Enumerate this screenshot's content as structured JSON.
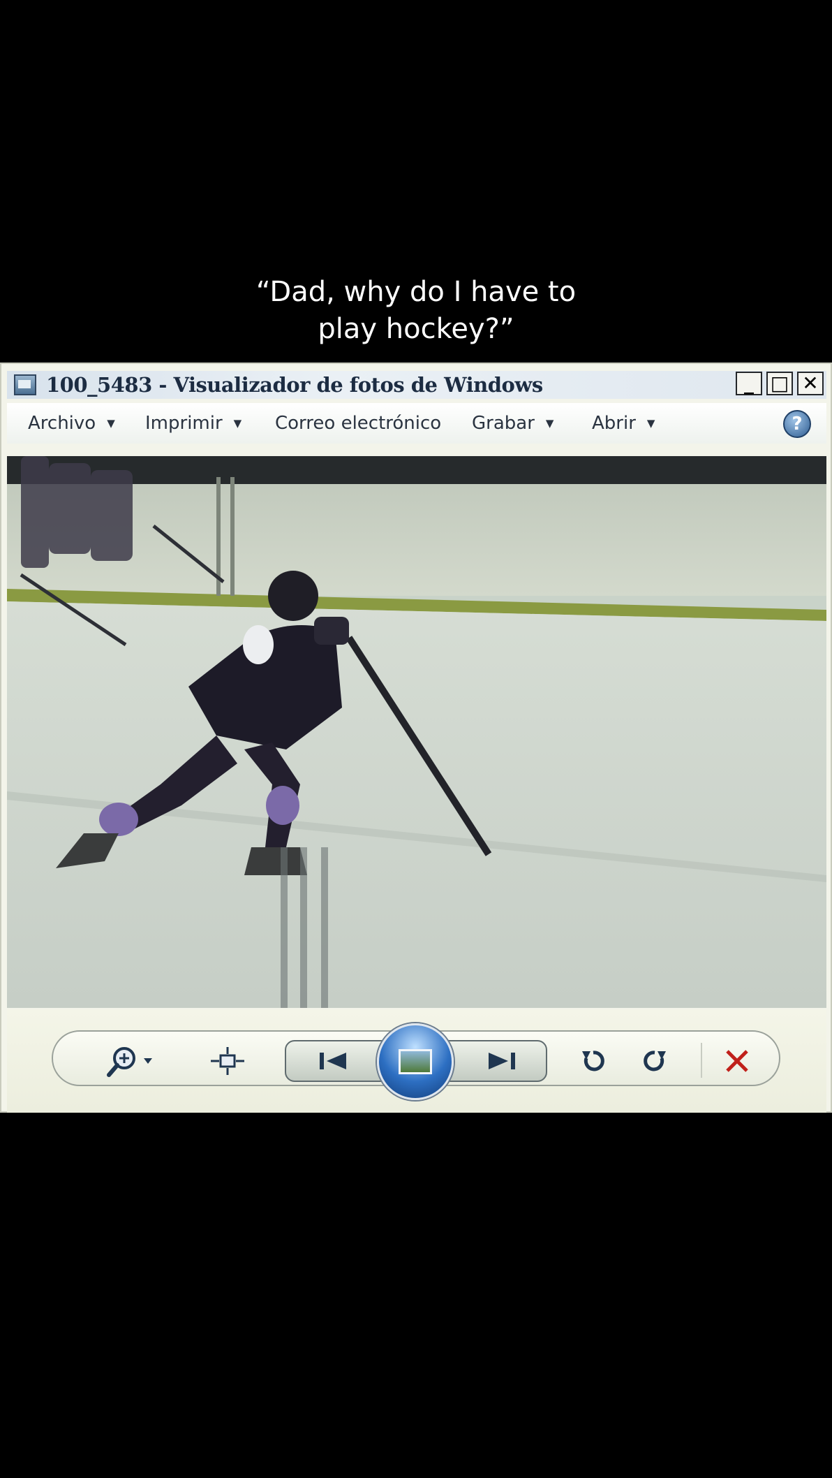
{
  "caption": {
    "line1": "“Dad, why do I have to",
    "line2": "play hockey?”"
  },
  "window": {
    "title": "100_5483 - Visualizador de fotos de Windows",
    "controls": {
      "minimize": "_",
      "maximize": "□",
      "close": "✕"
    }
  },
  "menu": {
    "items": [
      {
        "label": "Archivo",
        "has_dropdown": true
      },
      {
        "label": "Imprimir",
        "has_dropdown": true
      },
      {
        "label": "Correo electrónico",
        "has_dropdown": false
      },
      {
        "label": "Grabar",
        "has_dropdown": true
      },
      {
        "label": "Abrir",
        "has_dropdown": true
      }
    ],
    "caret": "▼",
    "help": "?"
  },
  "toolbar": {
    "icons": [
      "zoom-icon",
      "fit-window-icon",
      "previous-icon",
      "slideshow-icon",
      "next-icon",
      "rotate-left-icon",
      "rotate-right-icon",
      "delete-icon"
    ]
  },
  "colors": {
    "delete": "#c0201a",
    "nav_blue": "#2d6fc2",
    "icon_dark": "#1f3650"
  }
}
